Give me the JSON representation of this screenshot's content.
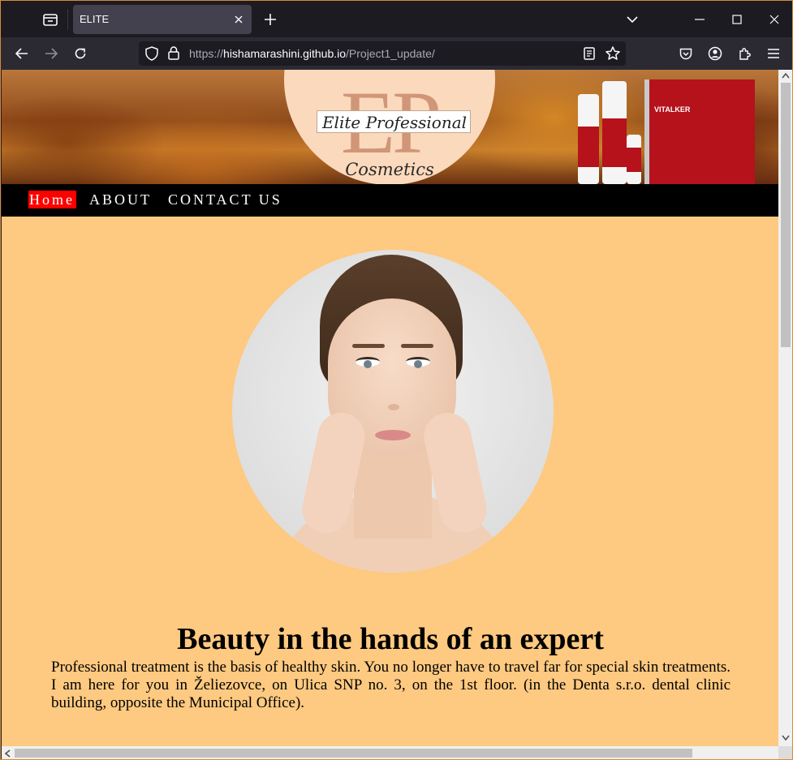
{
  "browser": {
    "tab_title": "ELITE",
    "url_base": "https://",
    "url_host": "hishamarashini.github.io",
    "url_path": "/Project1_update/"
  },
  "banner": {
    "logo_monogram": "EP",
    "logo_name": "Elite Professional",
    "logo_sub": "Cosmetics",
    "product_label": "VITALKER"
  },
  "menu": {
    "items": [
      {
        "label": "Home",
        "active": true
      },
      {
        "label": "ABOUT",
        "active": false
      },
      {
        "label": "CONTACT US",
        "active": false
      }
    ]
  },
  "content": {
    "heading": "Beauty in the hands of an expert",
    "paragraph": "Professional treatment is the basis of healthy skin. You no longer have to travel far for special skin treatments. I am here for you in Želiezovce, on Ulica SNP no. 3, on the 1st floor. (in the Denta s.r.o. dental clinic building, opposite the Municipal Office)."
  },
  "colors": {
    "page_background": "#fec980",
    "menu_background": "#000000",
    "active_menu": "#ff0000"
  }
}
